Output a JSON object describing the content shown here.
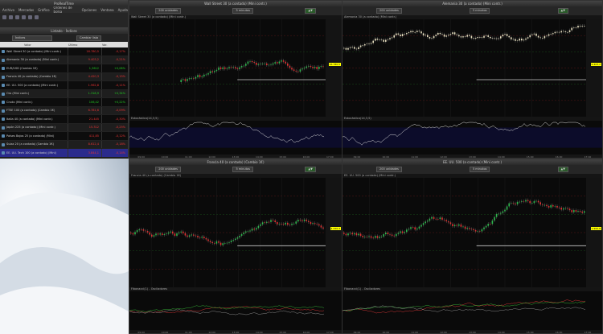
{
  "platform": {
    "title": "ProRealTime",
    "menu": [
      "Archivo",
      "Mercados",
      "Gráfico",
      "Órdenes de bolsa",
      "Opciones",
      "Ventana",
      "Ayuda"
    ]
  },
  "watchlist": {
    "title": "Listado - Índices",
    "selector": "Índices",
    "button": "Cambiar lista",
    "columns": [
      "Valor",
      "Último",
      "Var."
    ],
    "items": [
      {
        "name": "Wall Street 30 (a contado) (Mini contr.)",
        "last": "16.780,5",
        "chg": "-0,17%",
        "dir": "dn"
      },
      {
        "name": "Alemania 30 (a contado) (Mini contr.)",
        "last": "9.403,2",
        "chg": "-0,21%",
        "dir": "dn"
      },
      {
        "name": "EUR/USD (Cambio 1€)",
        "last": "1,3612",
        "chg": "+0,08%",
        "dir": "up"
      },
      {
        "name": "Francia 40 (a contado) (Cambio 1€)",
        "last": "4.420,3",
        "chg": "-0,15%",
        "dir": "dn"
      },
      {
        "name": "EE. UU. 500 (a contado) (Mini contr.)",
        "last": "1.962,8",
        "chg": "-0,11%",
        "dir": "dn"
      },
      {
        "name": "Oro (Mini contr.)",
        "last": "1.318,9",
        "chg": "+0,34%",
        "dir": "up"
      },
      {
        "name": "Crudo (Mini contr.)",
        "last": "106,42",
        "chg": "+0,22%",
        "dir": "up"
      },
      {
        "name": "FTSE 100 (a contado) (Cambio 1€)",
        "last": "6.781,6",
        "chg": "-0,09%",
        "dir": "dn"
      },
      {
        "name": "Italia 40 (a contado) (Mini contr.)",
        "last": "21.445",
        "chg": "-0,30%",
        "dir": "dn"
      },
      {
        "name": "Japón 225 (a contado) (Mini contr.)",
        "last": "15.312",
        "chg": "-0,25%",
        "dir": "dn"
      },
      {
        "name": "Países Bajos 25 (a contado) (Mini)",
        "last": "411,85",
        "chg": "-0,12%",
        "dir": "dn"
      },
      {
        "name": "Suiza 20 (a contado) (Cambio 1€)",
        "last": "8.612,4",
        "chg": "-0,18%",
        "dir": "dn"
      },
      {
        "name": "EE. UU. Tech 100 (a contado) (Mini)",
        "last": "3.844,1",
        "chg": "-0,14%",
        "dir": "dn"
      }
    ]
  },
  "charts": [
    {
      "title": "Wall Street 30 (a contado) (Mini contr.)",
      "period": "200 unidades",
      "interval": "5 minutos",
      "price": "16.780,5",
      "indicator": "Estocástico(14,3,5)",
      "up": "#2db84d",
      "dn": "#e03030"
    },
    {
      "title": "Alemania 30 (a contado) (Mini contr.)",
      "period": "200 unidades",
      "interval": "5 minutos",
      "price": "9.403,2",
      "indicator": "Estocástico(14,3,5)",
      "up": "#e8e0c0",
      "dn": "#e8e0c0"
    },
    {
      "title": "Francia 40 (a contado) (Cambio 1€)",
      "period": "200 unidades",
      "interval": "5 minutos",
      "price": "4.420,3",
      "indicator": "Fibonacci(1) - Osciladores",
      "up": "#2db84d",
      "dn": "#e03030"
    },
    {
      "title": "EE. UU. 500 (a contado) (Mini contr.)",
      "period": "200 unidades",
      "interval": "5 minutos",
      "price": "1.962,8",
      "indicator": "Fibonacci(1) - Osciladores",
      "up": "#2db84d",
      "dn": "#e03030"
    }
  ],
  "time_labels": [
    "09:00",
    "10:00",
    "11:00",
    "12:00",
    "13:00",
    "14:00",
    "15:00",
    "16:00",
    "17:00"
  ]
}
